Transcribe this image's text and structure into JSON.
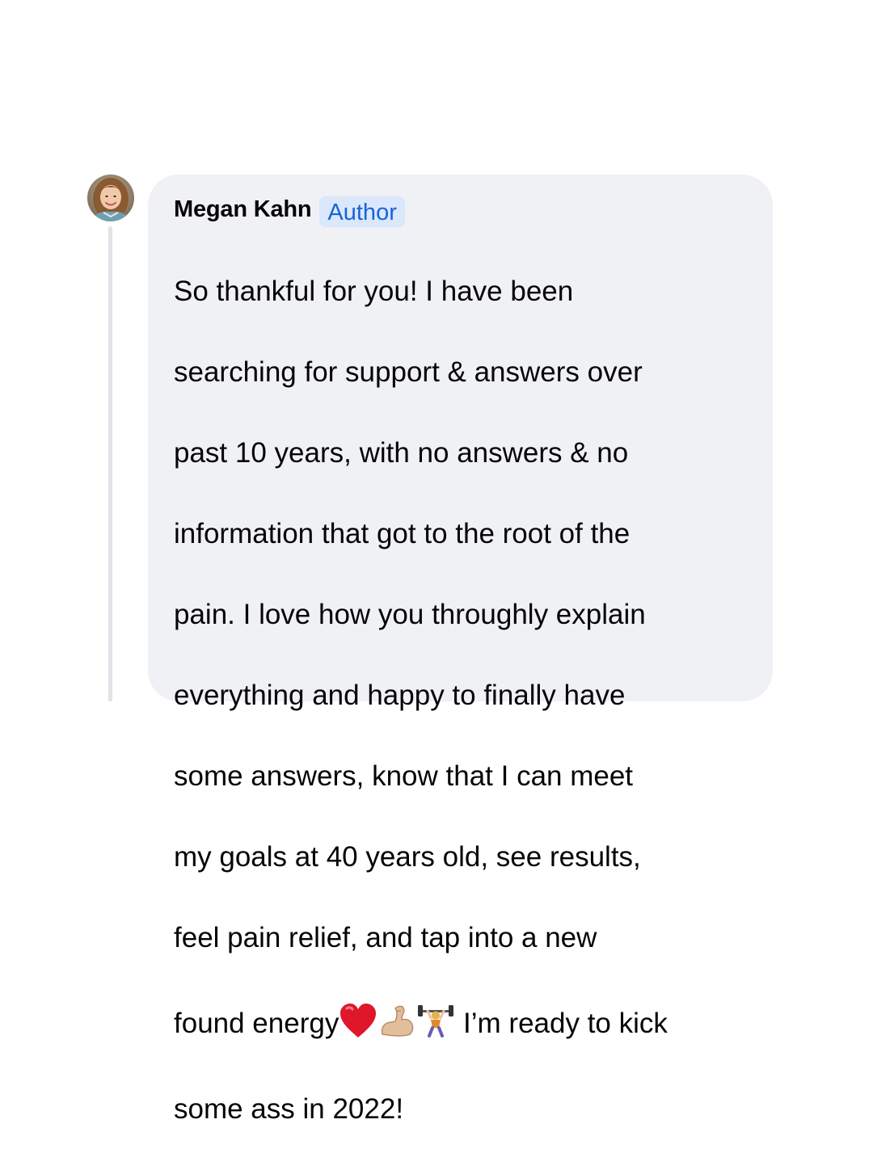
{
  "comment": {
    "author_name": "Megan Kahn",
    "author_badge": "Author",
    "avatar_icon": "user-avatar-photo",
    "lines": [
      "So thankful for you! I have been",
      "searching for support & answers over",
      "past 10 years, with no answers & no",
      "information that got to the root of the",
      "pain. I love how you throughly explain",
      "everything  and happy to finally have",
      "some answers, know that I can meet",
      "my goals at 40 years old, see results,",
      "feel pain relief, and tap into a new"
    ],
    "line_emoji_prefix": "found energy",
    "line_emoji_suffix": " I’m ready to kick",
    "last_line": "some ass in 2022!",
    "emojis": [
      "red-heart-icon",
      "flexed-biceps-icon",
      "weightlifter-icon"
    ]
  },
  "colors": {
    "bubble_bg": "#f0f1f5",
    "badge_bg": "#dbe7fb",
    "badge_text": "#1764d8",
    "text": "#050505",
    "thread_line": "#e1e3e8"
  }
}
